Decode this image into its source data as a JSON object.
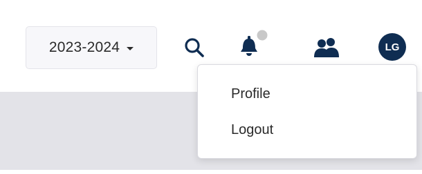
{
  "header": {
    "school_year": {
      "selected": "2023-2024"
    },
    "icons": {
      "search": "search-icon",
      "notifications": "bell-icon",
      "users": "users-icon"
    },
    "avatar_initials": "LG"
  },
  "user_menu": {
    "items": [
      {
        "label": "Profile"
      },
      {
        "label": "Logout"
      }
    ]
  },
  "colors": {
    "avatar_bg": "#0f2d52",
    "icon_primary": "#0f2d52",
    "notification_dot": "#c8c8c8",
    "content_band": "#e3e3e8",
    "select_bg": "#f7f7fa"
  }
}
